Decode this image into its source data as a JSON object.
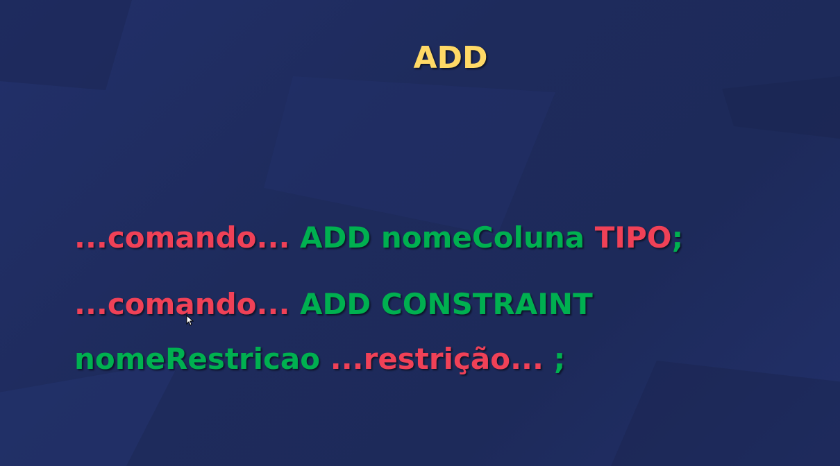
{
  "slide": {
    "title": "ADD",
    "line1": {
      "part1": "...comando...",
      "part2": "ADD nomeColuna",
      "part3": "TIPO",
      "part4": ";"
    },
    "line2": {
      "part1": "...comando...",
      "part2": "ADD CONSTRAINT"
    },
    "line3": {
      "part1": "nomeRestricao",
      "part2": "...restrição...",
      "part3": ";"
    }
  },
  "colors": {
    "background": "#1f2d5e",
    "title": "#ffd966",
    "placeholder_text": "#f04157",
    "keyword_text": "#00b050"
  },
  "icons": {
    "cursor": "mouse-pointer-icon"
  }
}
